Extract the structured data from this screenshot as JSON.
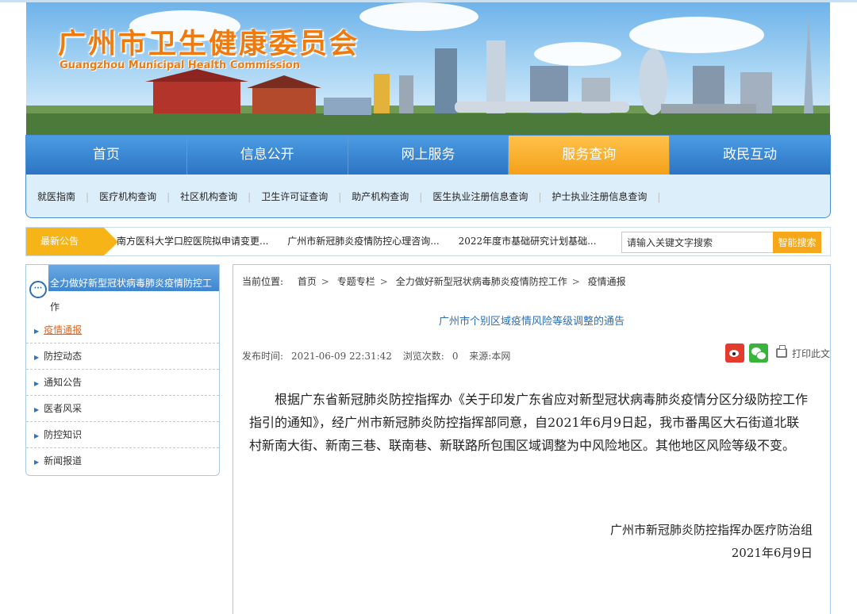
{
  "header": {
    "title_cn": "广州市卫生健康委员会",
    "title_en": "Guangzhou Municipal Health Commission"
  },
  "main_nav": [
    {
      "label": "首页",
      "active": false
    },
    {
      "label": "信息公开",
      "active": false
    },
    {
      "label": "网上服务",
      "active": false
    },
    {
      "label": "服务查询",
      "active": true
    },
    {
      "label": "政民互动",
      "active": false
    }
  ],
  "sub_nav": [
    "就医指南",
    "医疗机构查询",
    "社区机构查询",
    "卫生许可证查询",
    "助产机构查询",
    "医生执业注册信息查询",
    "护士执业注册信息查询"
  ],
  "notice": {
    "tag": "最新公告",
    "items": [
      "南方医科大学口腔医院拟申请变更...",
      "广州市新冠肺炎疫情防控心理咨询...",
      "2022年度市基础研究计划基础..."
    ]
  },
  "search": {
    "placeholder": "请输入关键文字搜索",
    "button": "智能搜索"
  },
  "sidebar": {
    "heading_line1": "全力做好新型冠状病毒肺炎疫情防控工",
    "heading_line2": "作",
    "items": [
      {
        "label": "疫情通报",
        "active": true
      },
      {
        "label": "防控动态",
        "active": false
      },
      {
        "label": "通知公告",
        "active": false
      },
      {
        "label": "医者风采",
        "active": false
      },
      {
        "label": "防控知识",
        "active": false
      },
      {
        "label": "新闻报道",
        "active": false
      }
    ]
  },
  "breadcrumb": {
    "label": "当前位置:",
    "items": [
      "首页",
      "专题专栏",
      "全力做好新型冠状病毒肺炎疫情防控工作",
      "疫情通报"
    ]
  },
  "article": {
    "title": "广州市个别区域疫情风险等级调整的通告",
    "publish_label": "发布时间:",
    "publish_time": "2021-06-09 22:31:42",
    "views_label": "浏览次数:",
    "views": "0",
    "source_label": "来源:",
    "source": "本网",
    "print_label": "打印此文",
    "body": "根据广东省新冠肺炎防控指挥办《关于印发广东省应对新型冠状病毒肺炎疫情分区分级防控工作指引的通知》，经广州市新冠肺炎防控指挥部同意，自2021年6月9日起，我市番禺区大石街道北联村新南大街、新南三巷、联南巷、新联路所包围区域调整为中风险地区。其他地区风险等级不变。",
    "signature": "广州市新冠肺炎防控指挥办医疗防治组",
    "date": "2021年6月9日"
  },
  "colors": {
    "brand_orange": "#ee7a10",
    "nav_blue": "#2c74c4",
    "nav_active": "#f5a01a",
    "title_blue": "#2c6fb8"
  }
}
